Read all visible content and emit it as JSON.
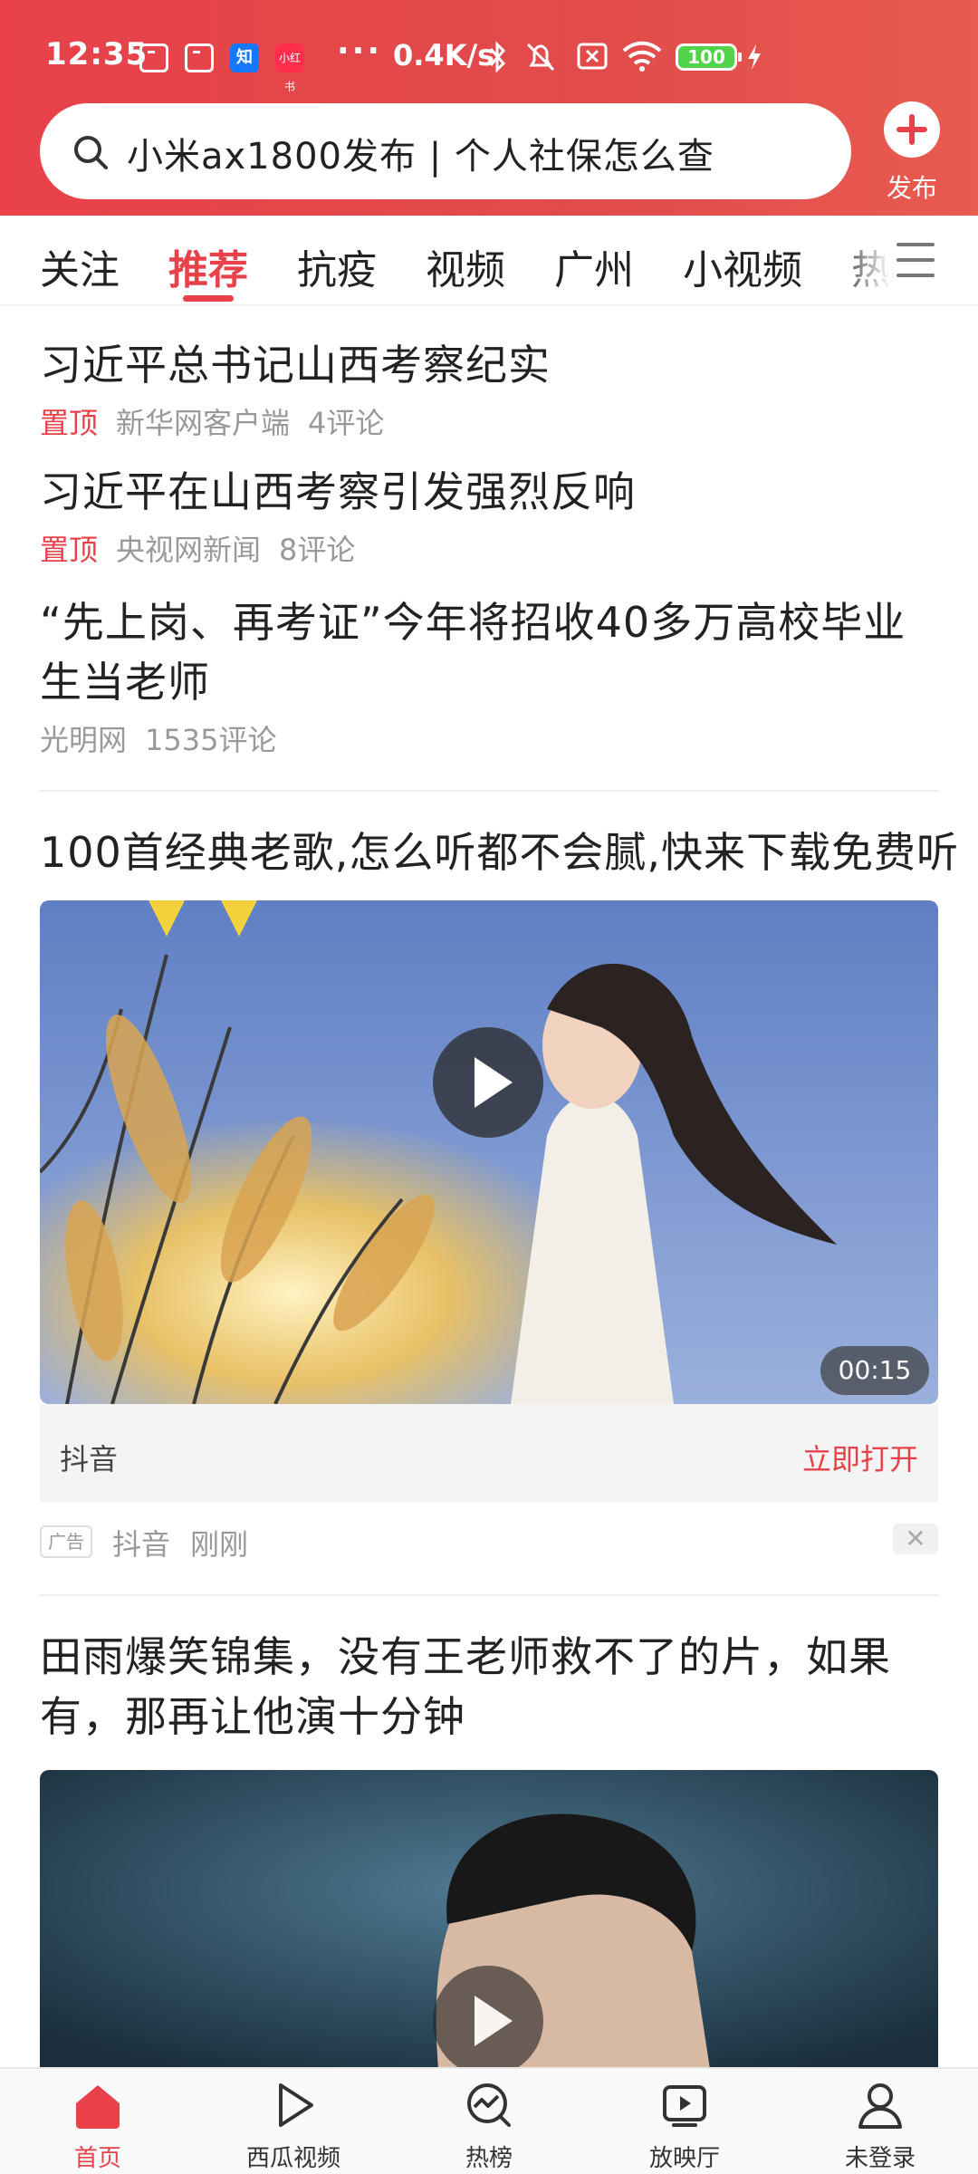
{
  "status_bar": {
    "time": "12:35",
    "notification_icons": [
      "calendar-icon",
      "calendar-icon",
      "zhihu-icon",
      "xiaohongshu-icon"
    ],
    "zhihu_label": "知",
    "xhs_label": "小红书",
    "more": "···",
    "net_speed": "0.4K/s",
    "battery": "100"
  },
  "search": {
    "text": "小米ax1800发布 | 个人社保怎么查"
  },
  "publish": {
    "label": "发布"
  },
  "tabs": [
    {
      "label": "关注"
    },
    {
      "label": "推荐"
    },
    {
      "label": "抗疫"
    },
    {
      "label": "视频"
    },
    {
      "label": "广州"
    },
    {
      "label": "小视频"
    },
    {
      "label": "热"
    }
  ],
  "active_tab": "推荐",
  "feed": [
    {
      "title": "习近平总书记山西考察纪实",
      "pin": "置顶",
      "source": "新华网客户端",
      "comments": "4评论"
    },
    {
      "title": "习近平在山西考察引发强烈反响",
      "pin": "置顶",
      "source": "央视网新闻",
      "comments": "8评论"
    },
    {
      "title": "“先上岗、再考证”今年将招收40多万高校毕业生当老师",
      "source": "光明网",
      "comments": "1535评论"
    }
  ],
  "ad": {
    "title": "100首经典老歌,怎么听都不会腻,快来下载免费听",
    "duration": "00:15",
    "source": "抖音",
    "open_label": "立即打开",
    "tag": "广告",
    "meta_source": "抖音",
    "meta_time": "刚刚",
    "close": "✕"
  },
  "video2": {
    "title": "田雨爆笑锦集，没有王老师救不了的片，如果有，那再让他演十分钟"
  },
  "bottom_nav": [
    {
      "label": "首页",
      "icon": "home-icon"
    },
    {
      "label": "西瓜视频",
      "icon": "play-icon"
    },
    {
      "label": "热榜",
      "icon": "trending-icon"
    },
    {
      "label": "放映厅",
      "icon": "screen-icon"
    },
    {
      "label": "未登录",
      "icon": "user-icon"
    }
  ],
  "colors": {
    "accent": "#e8414a",
    "battery": "#52d34a"
  }
}
